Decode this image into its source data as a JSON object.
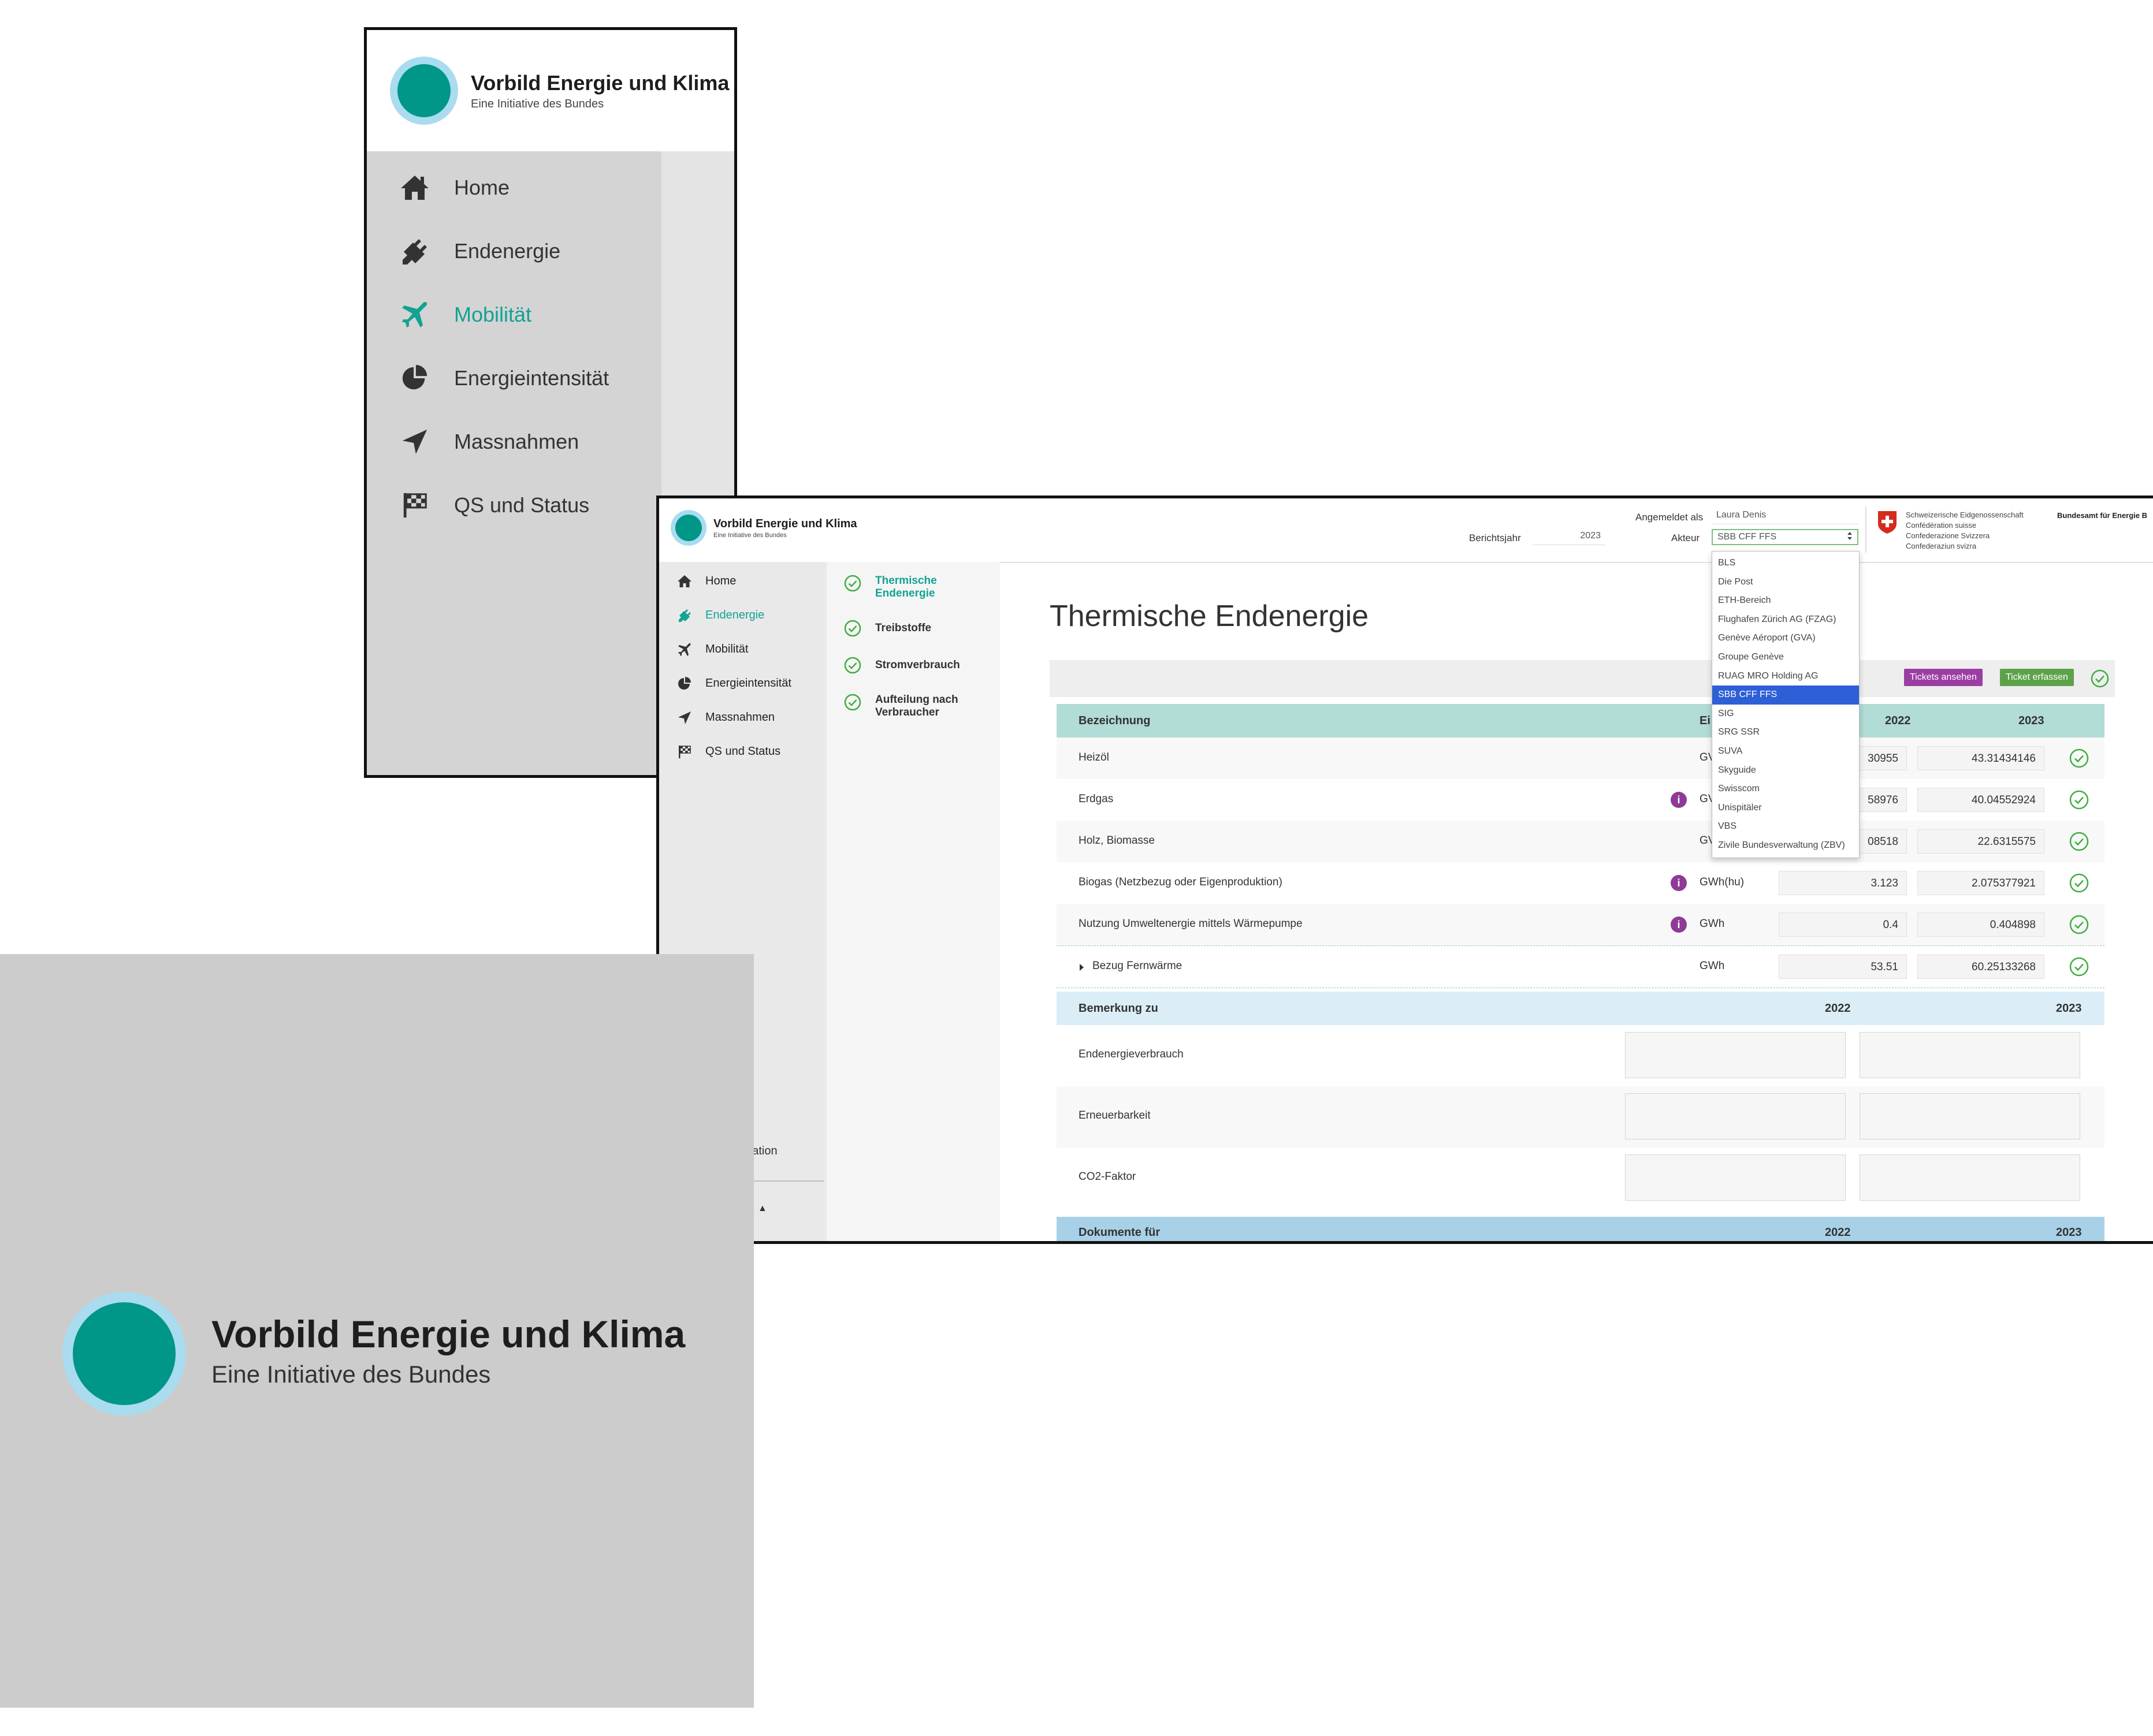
{
  "brand": {
    "title": "Vorbild Energie und Klima",
    "subtitle": "Eine Initiative des Bundes",
    "teal": "#009688",
    "halo": "#a9dcef"
  },
  "zoom_nav": {
    "items": [
      {
        "label": "Home",
        "icon": "home-icon"
      },
      {
        "label": "Endenergie",
        "icon": "plug-icon"
      },
      {
        "label": "Mobilität",
        "icon": "plane-icon",
        "active": true
      },
      {
        "label": "Energieintensität",
        "icon": "pie-chart-icon"
      },
      {
        "label": "Massnahmen",
        "icon": "paper-plane-icon"
      },
      {
        "label": "QS und Status",
        "icon": "flag-checkered-icon"
      }
    ]
  },
  "header": {
    "logged_in_label": "Angemeldet als",
    "user": "Laura Denis",
    "year_label": "Berichtsjahr",
    "year": "2023",
    "actor_label": "Akteur",
    "actor": "SBB CFF FFS",
    "confed_lines": [
      "Schweizerische Eidgenossenschaft",
      "Confédération suisse",
      "Confederazione Svizzera",
      "Confederaziun svizra"
    ],
    "office": "Bundesamt für Energie B"
  },
  "side_nav": {
    "items": [
      {
        "label": "Home"
      },
      {
        "label": "Endenergie",
        "active": true
      },
      {
        "label": "Mobilität"
      },
      {
        "label": "Energieintensität"
      },
      {
        "label": "Massnahmen"
      },
      {
        "label": "QS und Status"
      }
    ],
    "peek": [
      "g",
      "tration"
    ]
  },
  "sub_nav": {
    "items": [
      {
        "label": "Thermische Endenergie",
        "active": true
      },
      {
        "label": "Treibstoffe"
      },
      {
        "label": "Stromverbrauch"
      },
      {
        "label": "Aufteilung nach Verbraucher"
      }
    ]
  },
  "page": {
    "title": "Thermische Endenergie",
    "tickets_view": "Tickets ansehen",
    "ticket_new": "Ticket erfassen"
  },
  "table": {
    "col_name": "Bezeichnung",
    "col_unit_partial": "Ei",
    "col_y1": "2022",
    "col_y2": "2023",
    "rows": [
      {
        "name": "Heizöl",
        "unit": "GV",
        "y1": "30955",
        "y2": "43.31434146"
      },
      {
        "name": "Erdgas",
        "unit": "GV",
        "y1": "58976",
        "y2": "40.04552924",
        "info": "i"
      },
      {
        "name": "Holz, Biomasse",
        "unit": "GV",
        "y1": "08518",
        "y2": "22.6315575"
      },
      {
        "name": "Biogas (Netzbezug oder Eigenproduktion)",
        "unit": "GWh(hu)",
        "y1": "3.123",
        "y2": "2.075377921",
        "info": "i"
      },
      {
        "name": "Nutzung Umweltenergie mittels Wärmepumpe",
        "unit": "GWh",
        "y1": "0.4",
        "y2": "0.404898",
        "info": "i"
      },
      {
        "name": "Bezug Fernwärme",
        "unit": "GWh",
        "y1": "53.51",
        "y2": "60.25133268"
      }
    ]
  },
  "remarks": {
    "title": "Bemerkung zu",
    "y1": "2022",
    "y2": "2023",
    "rows": [
      "Endenergieverbrauch",
      "Erneuerbarkeit",
      "CO2-Faktor"
    ]
  },
  "documents": {
    "title": "Dokumente für",
    "y1": "2022",
    "y2": "2023"
  },
  "dropdown": {
    "options": [
      "BLS",
      "Die Post",
      "ETH-Bereich",
      "Flughafen Zürich AG (FZAG)",
      "Genève Aéroport (GVA)",
      "Groupe Genève",
      "RUAG MRO Holding AG",
      "SBB CFF FFS",
      "SIG",
      "SRG SSR",
      "SUVA",
      "Skyguide",
      "Swisscom",
      "Unispitäler",
      "VBS",
      "Zivile Bundesverwaltung (ZBV)"
    ],
    "selected": "SBB CFF FFS",
    "highlight": "#2d5fd6"
  }
}
